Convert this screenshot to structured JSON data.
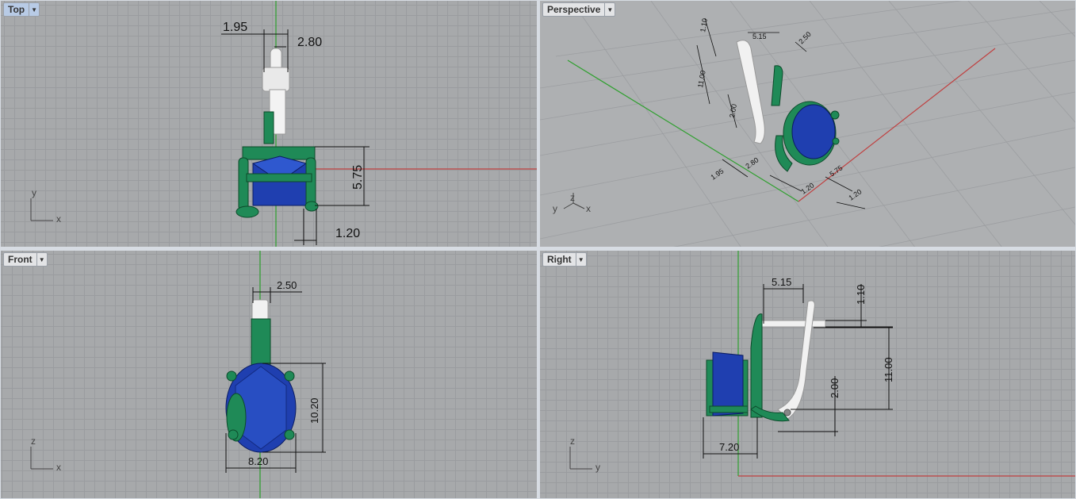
{
  "viewports": {
    "top": {
      "title": "Top",
      "axes": {
        "h": "x",
        "v": "y"
      }
    },
    "persp": {
      "title": "Perspective",
      "axes": {
        "a": "y",
        "b": "z",
        "c": "x"
      }
    },
    "front": {
      "title": "Front",
      "axes": {
        "h": "x",
        "v": "z"
      }
    },
    "right": {
      "title": "Right",
      "axes": {
        "h": "y",
        "v": "z"
      }
    }
  },
  "dimensions": {
    "top": [
      "1.95",
      "2.80",
      "5.75",
      "1.20"
    ],
    "persp": [
      "5.15",
      "2.50",
      "1.10",
      "11.00",
      "2.00",
      "1.95",
      "2.80",
      "1.20",
      "1.20",
      "5.75"
    ],
    "front": [
      "2.50",
      "10.20",
      "8.20"
    ],
    "right": [
      "5.15",
      "1.10",
      "11.00",
      "2.00",
      "7.20"
    ]
  },
  "colors": {
    "setting_green": "#1f8a57",
    "stone_blue": "#1f3fb0",
    "hook_white": "#f1f1f1",
    "axis_red": "#c04040",
    "axis_green": "#2fa02f"
  }
}
